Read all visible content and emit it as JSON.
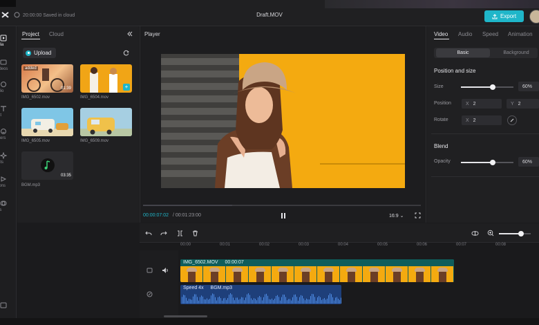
{
  "topbar": {
    "save_status": "20:00:00 Saved in cloud",
    "doc_title": "Draft.MOV",
    "export_label": "Export"
  },
  "rail": {
    "items": [
      {
        "label": "Media",
        "icon": "media-icon"
      },
      {
        "label": "Videos",
        "icon": "stock-video-icon"
      },
      {
        "label": "Audio",
        "icon": "audio-icon"
      },
      {
        "label": "Text",
        "icon": "text-icon"
      },
      {
        "label": "Stickers",
        "icon": "sticker-icon"
      },
      {
        "label": "Effects",
        "icon": "effects-icon"
      },
      {
        "label": "Transitions",
        "icon": "transitions-icon"
      },
      {
        "label": "Filters",
        "icon": "filters-icon"
      }
    ],
    "visible_labels": [
      "edia",
      "videos",
      "udio",
      "ext",
      "ckers",
      "ects",
      "itions",
      "ers"
    ]
  },
  "media_panel": {
    "tabs": [
      "Project",
      "Cloud"
    ],
    "upload_label": "Upload",
    "items": [
      {
        "name": "IMG_6502.mov",
        "duration": "01:39",
        "badge": "added"
      },
      {
        "name": "IMG_6504.mov",
        "duration": "",
        "badge": ""
      },
      {
        "name": "IMG_6505.mov",
        "duration": "",
        "badge": ""
      },
      {
        "name": "IMG_6509.mov",
        "duration": "",
        "badge": ""
      },
      {
        "name": "BGM.mp3",
        "duration": "03:35",
        "badge": ""
      }
    ]
  },
  "player": {
    "title": "Player",
    "current_time": "00:00:07:02",
    "total_time": "/ 00:01:23:00",
    "aspect_ratio": "16:9",
    "progress": 0.32
  },
  "properties": {
    "tabs": [
      "Video",
      "Audio",
      "Speed",
      "Animation"
    ],
    "segments": [
      "Basic",
      "Background"
    ],
    "position_and_size": {
      "title": "Position and size",
      "size_label": "Size",
      "size_value": "60%",
      "size_level": 0.6,
      "position_label": "Position",
      "position_x_key": "X",
      "position_x": "2",
      "position_y_key": "Y",
      "position_y": "2",
      "rotate_label": "Rotate",
      "rotate_key": "X",
      "rotate_value": "2"
    },
    "blend": {
      "title": "Blend",
      "opacity_label": "Opacity",
      "opacity_value": "60%",
      "opacity_level": 0.6
    }
  },
  "timeline": {
    "ruler": [
      "00:00",
      "00:01",
      "00:02",
      "00:03",
      "00:04",
      "00:05",
      "00:06",
      "00:07",
      "00:08"
    ],
    "video_clip": {
      "name": "IMG_6502.MOV",
      "duration": "00:00:07"
    },
    "audio_clip": {
      "speed": "Speed 4x",
      "name": "BGM.mp3"
    },
    "zoom_level": 0.7
  },
  "colors": {
    "accent": "#1fb6c9",
    "video_clip": "#0f6f6d",
    "audio_clip": "#1e3f7a",
    "background": "#1b1b1d"
  }
}
